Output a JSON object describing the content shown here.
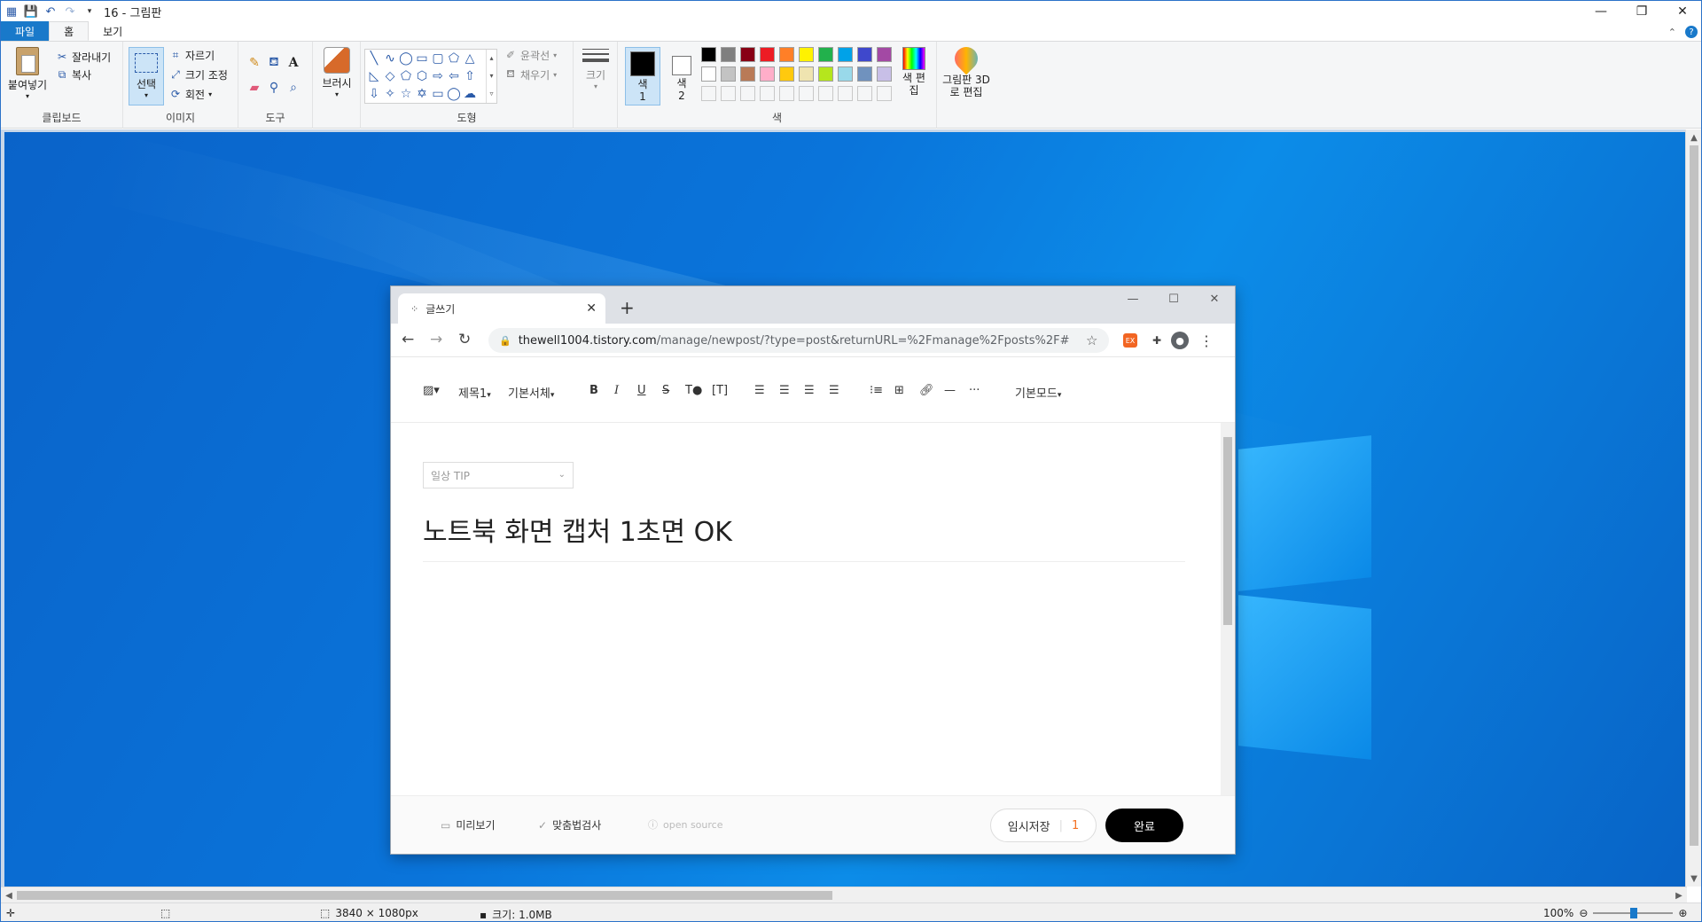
{
  "app": {
    "title": "16 - 그림판"
  },
  "tabs": {
    "file": "파일",
    "home": "홈",
    "view": "보기"
  },
  "ribbon": {
    "clipboard": {
      "label": "클립보드",
      "paste": "붙여넣기",
      "cut": "잘라내기",
      "copy": "복사"
    },
    "image": {
      "label": "이미지",
      "select": "선택",
      "crop": "자르기",
      "resize": "크기 조정",
      "rotate": "회전"
    },
    "tools": {
      "label": "도구"
    },
    "brush": {
      "label": "브러시"
    },
    "shapes": {
      "label": "도형",
      "outline": "윤곽선",
      "fill": "채우기"
    },
    "size": {
      "label": "크기"
    },
    "colors": {
      "label": "색",
      "color1": "색 1",
      "color2": "색 2",
      "edit": "색 편집",
      "paint3d": "그림판 3D로 편집"
    }
  },
  "palette_row1": [
    "#000000",
    "#7f7f7f",
    "#880015",
    "#ed1c24",
    "#ff7f27",
    "#fff200",
    "#22b14c",
    "#00a2e8",
    "#3f48cc",
    "#a349a4"
  ],
  "palette_row2": [
    "#ffffff",
    "#c3c3c3",
    "#b97a57",
    "#ffaec9",
    "#ffc90e",
    "#efe4b0",
    "#b5e61d",
    "#99d9ea",
    "#7092be",
    "#c8bfe7"
  ],
  "status": {
    "dimensions": "3840 × 1080px",
    "size": "크기: 1.0MB",
    "zoom": "100%"
  },
  "browser": {
    "tab_title": "글쓰기",
    "url_domain": "thewell1004.tistory.com",
    "url_path": "/manage/newpost/?type=post&returnURL=%2Fmanage%2Fposts%2F#",
    "toolbar": {
      "heading": "제목1",
      "font": "기본서체",
      "mode": "기본모드"
    },
    "category": "일상 TIP",
    "post_title": "노트북 화면 캡처 1초면 OK",
    "footer": {
      "preview": "미리보기",
      "spellcheck": "맞춤법검사",
      "opensource": "open source",
      "draft": "임시저장",
      "draft_count": "1",
      "done": "완료"
    }
  }
}
